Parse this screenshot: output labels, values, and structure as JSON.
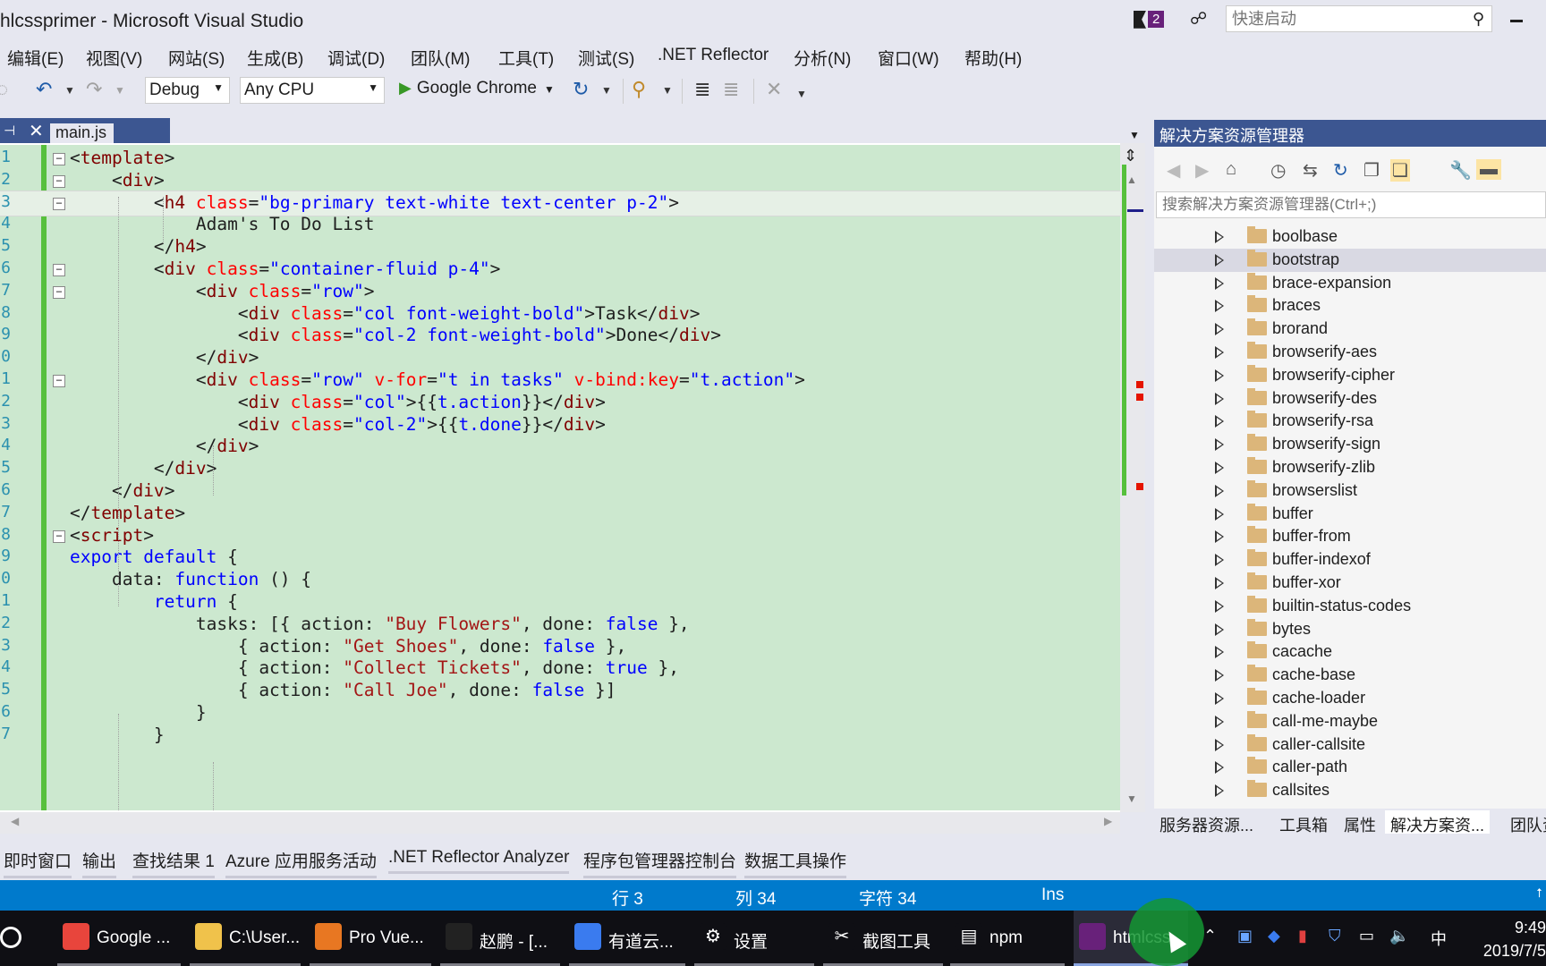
{
  "window": {
    "title": "hlcssprimer - Microsoft Visual Studio",
    "notification_count": "2",
    "quick_launch_placeholder": "快速启动"
  },
  "menu": [
    "编辑(E)",
    "视图(V)",
    "网站(S)",
    "生成(B)",
    "调试(D)",
    "团队(M)",
    "工具(T)",
    "测试(S)",
    ".NET Reflector",
    "分析(N)",
    "窗口(W)",
    "帮助(H)"
  ],
  "toolbar": {
    "configuration": "Debug",
    "platform": "Any CPU",
    "run_target": "Google Chrome"
  },
  "editor": {
    "tab_name": "main.js",
    "current_line": 3,
    "lines": [
      {
        "n": "1",
        "segs": [
          [
            "t-br",
            "<"
          ],
          [
            "t-tag",
            "template"
          ],
          [
            "t-br",
            ">"
          ]
        ]
      },
      {
        "n": "2",
        "segs": [
          [
            "t-def",
            "    "
          ],
          [
            "t-br",
            "<"
          ],
          [
            "t-tag",
            "div"
          ],
          [
            "t-br",
            ">"
          ]
        ]
      },
      {
        "n": "3",
        "segs": [
          [
            "t-def",
            "        "
          ],
          [
            "t-br",
            "<"
          ],
          [
            "t-tag",
            "h4 "
          ],
          [
            "t-attr",
            "class"
          ],
          [
            "t-def",
            "="
          ],
          [
            "t-val",
            "\"bg-primary text-white text-center p-2\""
          ],
          [
            "t-br",
            ">"
          ]
        ]
      },
      {
        "n": "4",
        "segs": [
          [
            "t-def",
            "            Adam's To Do List"
          ]
        ]
      },
      {
        "n": "5",
        "segs": [
          [
            "t-def",
            "        "
          ],
          [
            "t-br",
            "</"
          ],
          [
            "t-tag",
            "h4"
          ],
          [
            "t-br",
            ">"
          ]
        ]
      },
      {
        "n": "6",
        "segs": [
          [
            "t-def",
            "        "
          ],
          [
            "t-br",
            "<"
          ],
          [
            "t-tag",
            "div "
          ],
          [
            "t-attr",
            "class"
          ],
          [
            "t-def",
            "="
          ],
          [
            "t-val",
            "\"container-fluid p-4\""
          ],
          [
            "t-br",
            ">"
          ]
        ]
      },
      {
        "n": "7",
        "segs": [
          [
            "t-def",
            "            "
          ],
          [
            "t-br",
            "<"
          ],
          [
            "t-tag",
            "div "
          ],
          [
            "t-attr",
            "class"
          ],
          [
            "t-def",
            "="
          ],
          [
            "t-val",
            "\"row\""
          ],
          [
            "t-br",
            ">"
          ]
        ]
      },
      {
        "n": "8",
        "segs": [
          [
            "t-def",
            "                "
          ],
          [
            "t-br",
            "<"
          ],
          [
            "t-tag",
            "div "
          ],
          [
            "t-attr",
            "class"
          ],
          [
            "t-def",
            "="
          ],
          [
            "t-val",
            "\"col font-weight-bold\""
          ],
          [
            "t-br",
            ">"
          ],
          [
            "t-def",
            "Task"
          ],
          [
            "t-br",
            "</"
          ],
          [
            "t-tag",
            "div"
          ],
          [
            "t-br",
            ">"
          ]
        ]
      },
      {
        "n": "9",
        "segs": [
          [
            "t-def",
            "                "
          ],
          [
            "t-br",
            "<"
          ],
          [
            "t-tag",
            "div "
          ],
          [
            "t-attr",
            "class"
          ],
          [
            "t-def",
            "="
          ],
          [
            "t-val",
            "\"col-2 font-weight-bold\""
          ],
          [
            "t-br",
            ">"
          ],
          [
            "t-def",
            "Done"
          ],
          [
            "t-br",
            "</"
          ],
          [
            "t-tag",
            "div"
          ],
          [
            "t-br",
            ">"
          ]
        ]
      },
      {
        "n": "0",
        "segs": [
          [
            "t-def",
            "            "
          ],
          [
            "t-br",
            "</"
          ],
          [
            "t-tag",
            "div"
          ],
          [
            "t-br",
            ">"
          ]
        ]
      },
      {
        "n": "1",
        "segs": [
          [
            "t-def",
            "            "
          ],
          [
            "t-br",
            "<"
          ],
          [
            "t-tag",
            "div "
          ],
          [
            "t-attr",
            "class"
          ],
          [
            "t-def",
            "="
          ],
          [
            "t-val",
            "\"row\" "
          ],
          [
            "t-attr",
            "v-for"
          ],
          [
            "t-def",
            "="
          ],
          [
            "t-val",
            "\"t in tasks\" "
          ],
          [
            "t-attr",
            "v-bind:key"
          ],
          [
            "t-def",
            "="
          ],
          [
            "t-val",
            "\"t.action\""
          ],
          [
            "t-br",
            ">"
          ]
        ]
      },
      {
        "n": "2",
        "segs": [
          [
            "t-def",
            "                "
          ],
          [
            "t-br",
            "<"
          ],
          [
            "t-tag",
            "div "
          ],
          [
            "t-attr",
            "class"
          ],
          [
            "t-def",
            "="
          ],
          [
            "t-val",
            "\"col\""
          ],
          [
            "t-br",
            ">"
          ],
          [
            "t-def",
            "{{"
          ],
          [
            "t-val",
            "t.action"
          ],
          [
            "t-def",
            "}}"
          ],
          [
            "t-br",
            "</"
          ],
          [
            "t-tag",
            "div"
          ],
          [
            "t-br",
            ">"
          ]
        ]
      },
      {
        "n": "3",
        "segs": [
          [
            "t-def",
            "                "
          ],
          [
            "t-br",
            "<"
          ],
          [
            "t-tag",
            "div "
          ],
          [
            "t-attr",
            "class"
          ],
          [
            "t-def",
            "="
          ],
          [
            "t-val",
            "\"col-2\""
          ],
          [
            "t-br",
            ">"
          ],
          [
            "t-def",
            "{{"
          ],
          [
            "t-val",
            "t.done"
          ],
          [
            "t-def",
            "}}"
          ],
          [
            "t-br",
            "</"
          ],
          [
            "t-tag",
            "div"
          ],
          [
            "t-br",
            ">"
          ]
        ]
      },
      {
        "n": "4",
        "segs": [
          [
            "t-def",
            "            "
          ],
          [
            "t-br",
            "</"
          ],
          [
            "t-tag",
            "div"
          ],
          [
            "t-br",
            ">"
          ]
        ]
      },
      {
        "n": "5",
        "segs": [
          [
            "t-def",
            "        "
          ],
          [
            "t-br",
            "</"
          ],
          [
            "t-tag",
            "div"
          ],
          [
            "t-br",
            ">"
          ]
        ]
      },
      {
        "n": "6",
        "segs": [
          [
            "t-def",
            "    "
          ],
          [
            "t-br",
            "</"
          ],
          [
            "t-tag",
            "div"
          ],
          [
            "t-br",
            ">"
          ]
        ]
      },
      {
        "n": "7",
        "segs": [
          [
            "t-br",
            "</"
          ],
          [
            "t-tag",
            "template"
          ],
          [
            "t-br",
            ">"
          ]
        ]
      },
      {
        "n": "8",
        "segs": [
          [
            "t-br",
            "<"
          ],
          [
            "t-tag",
            "script"
          ],
          [
            "t-br",
            ">"
          ]
        ]
      },
      {
        "n": "9",
        "segs": [
          [
            "t-kw",
            "export"
          ],
          [
            "t-def",
            " "
          ],
          [
            "t-kw",
            "default"
          ],
          [
            "t-def",
            " {"
          ]
        ]
      },
      {
        "n": "0",
        "segs": [
          [
            "t-def",
            "    data: "
          ],
          [
            "t-kw",
            "function"
          ],
          [
            "t-def",
            " () {"
          ]
        ]
      },
      {
        "n": "1",
        "segs": [
          [
            "t-def",
            "        "
          ],
          [
            "t-kw",
            "return"
          ],
          [
            "t-def",
            " {"
          ]
        ]
      },
      {
        "n": "2",
        "segs": [
          [
            "t-def",
            "            tasks: [{ action: "
          ],
          [
            "t-str",
            "\"Buy Flowers\""
          ],
          [
            "t-def",
            ", done: "
          ],
          [
            "t-kw",
            "false"
          ],
          [
            "t-def",
            " },"
          ]
        ]
      },
      {
        "n": "3",
        "segs": [
          [
            "t-def",
            "                { action: "
          ],
          [
            "t-str",
            "\"Get Shoes\""
          ],
          [
            "t-def",
            ", done: "
          ],
          [
            "t-kw",
            "false"
          ],
          [
            "t-def",
            " },"
          ]
        ]
      },
      {
        "n": "4",
        "segs": [
          [
            "t-def",
            "                { action: "
          ],
          [
            "t-str",
            "\"Collect Tickets\""
          ],
          [
            "t-def",
            ", done: "
          ],
          [
            "t-kw",
            "true"
          ],
          [
            "t-def",
            " },"
          ]
        ]
      },
      {
        "n": "5",
        "segs": [
          [
            "t-def",
            "                { action: "
          ],
          [
            "t-str",
            "\"Call Joe\""
          ],
          [
            "t-def",
            ", done: "
          ],
          [
            "t-kw",
            "false"
          ],
          [
            "t-def",
            " }]"
          ]
        ]
      },
      {
        "n": "6",
        "segs": [
          [
            "t-def",
            "            }"
          ]
        ]
      },
      {
        "n": "7",
        "segs": [
          [
            "t-def",
            "        }"
          ]
        ]
      }
    ]
  },
  "solution_explorer": {
    "title": "解决方案资源管理器",
    "search_placeholder": "搜索解决方案资源管理器(Ctrl+;)",
    "selected": "bootstrap",
    "items": [
      "boolbase",
      "bootstrap",
      "brace-expansion",
      "braces",
      "brorand",
      "browserify-aes",
      "browserify-cipher",
      "browserify-des",
      "browserify-rsa",
      "browserify-sign",
      "browserify-zlib",
      "browserslist",
      "buffer",
      "buffer-from",
      "buffer-indexof",
      "buffer-xor",
      "builtin-status-codes",
      "bytes",
      "cacache",
      "cache-base",
      "cache-loader",
      "call-me-maybe",
      "caller-callsite",
      "caller-path",
      "callsites"
    ],
    "tabs": [
      "服务器资源...",
      "工具箱",
      "属性",
      "解决方案资...",
      "团队资"
    ]
  },
  "bottom_tabs": [
    "即时窗口",
    "输出",
    "查找结果 1",
    "Azure 应用服务活动",
    ".NET Reflector Analyzer",
    "程序包管理器控制台",
    "数据工具操作"
  ],
  "status": {
    "line": "行 3",
    "col": "列 34",
    "char": "字符 34",
    "mode": "Ins"
  },
  "taskbar": {
    "items": [
      {
        "label": "Google ...",
        "icon": "chrome-icon",
        "color": "#e8453c"
      },
      {
        "label": "C:\\User...",
        "icon": "folder-icon",
        "color": "#f0c24b"
      },
      {
        "label": "Pro Vue...",
        "icon": "pdf-icon",
        "color": "#e87722"
      },
      {
        "label": "赵鹏 - [...",
        "icon": "fox-icon",
        "color": "#222222"
      },
      {
        "label": "有道云...",
        "icon": "youdao-note-icon",
        "color": "#3a7bef"
      },
      {
        "label": "设置",
        "icon": "settings-icon",
        "color": "#0f0f14"
      },
      {
        "label": "截图工具",
        "icon": "snipping-tool-icon",
        "color": "#0f0f14"
      },
      {
        "label": "npm",
        "icon": "terminal-icon",
        "color": "#0f0f14"
      },
      {
        "label": "htmlcss...",
        "icon": "visual-studio-icon",
        "color": "#68217a"
      }
    ],
    "ime": "中",
    "time": "9:49",
    "date": "2019/7/5"
  }
}
